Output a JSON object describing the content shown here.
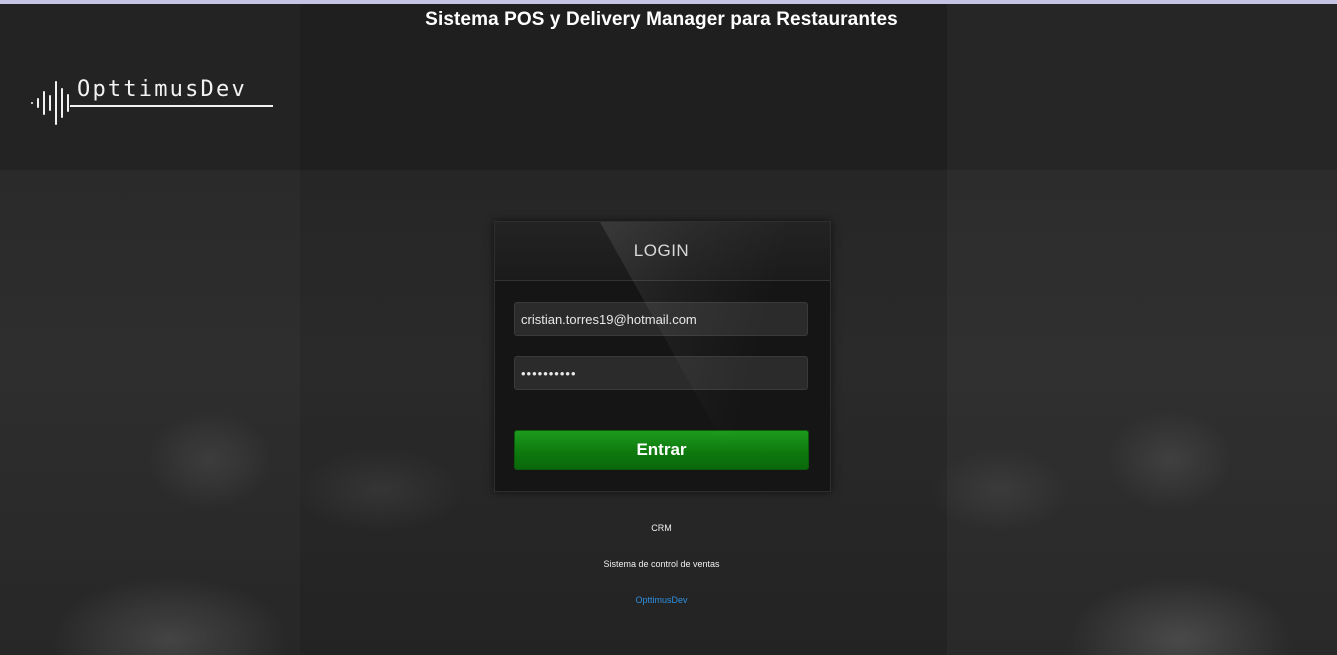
{
  "app_title": "Sistema POS y Delivery Manager para Restaurantes",
  "brand": {
    "logo_text": "OpttimusDev",
    "logo_icon": "sound-wave-icon"
  },
  "login": {
    "title": "LOGIN",
    "email_value": "cristian.torres19@hotmail.com",
    "password_value": "••••••••••",
    "submit_label": "Entrar"
  },
  "footer": {
    "crm_label": "CRM",
    "subtitle": "Sistema de control de ventas",
    "link_label": "OpttimusDev"
  },
  "colors": {
    "accent_green": "#0e7a0e",
    "link_blue": "#2f8fe0",
    "top_bar": "#c7c3e3"
  }
}
